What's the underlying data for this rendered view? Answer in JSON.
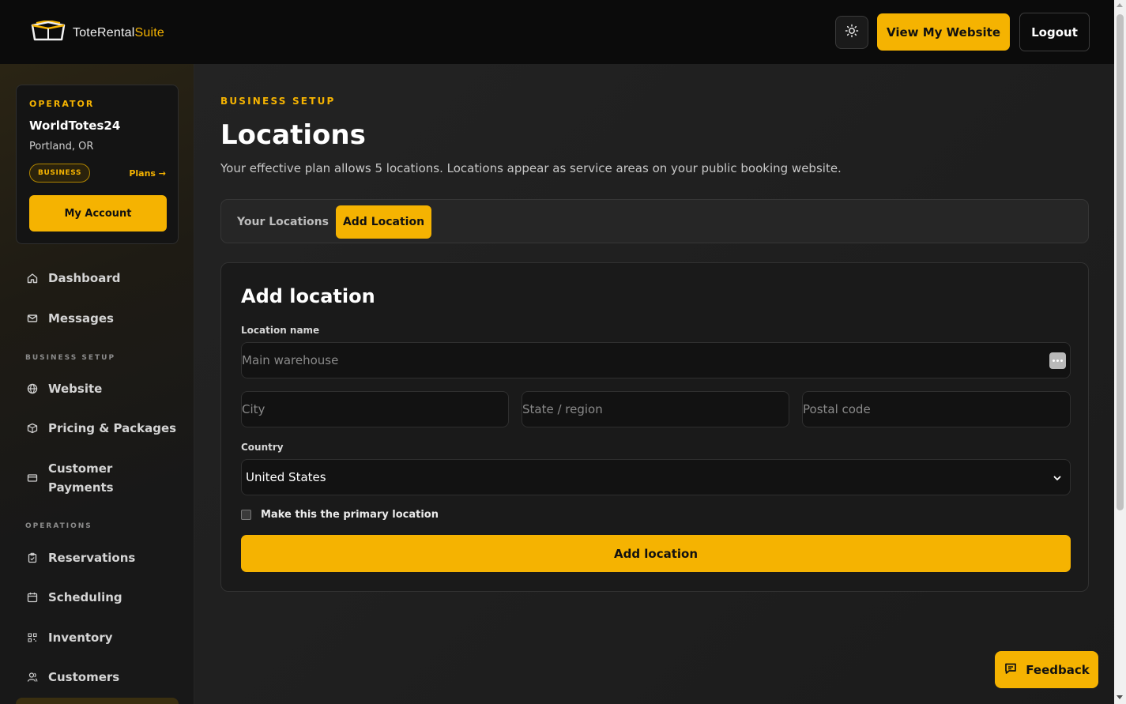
{
  "header": {
    "logo": {
      "part1": "ToteRental",
      "part2": "Suite"
    },
    "theme_toggle_icon": "sun-icon",
    "view_website_label": "View My Website",
    "logout_label": "Logout"
  },
  "sidebar": {
    "operator_label": "OPERATOR",
    "operator_name": "WorldTotes24",
    "operator_location": "Portland, OR",
    "plan_badge": "BUSINESS",
    "plans_link": "Plans →",
    "account_button": "My Account",
    "items": [
      {
        "label": "Dashboard",
        "icon": "home-icon"
      },
      {
        "label": "Messages",
        "icon": "mail-icon"
      },
      {
        "label": "Website",
        "icon": "globe-icon"
      },
      {
        "label": "Pricing & Packages",
        "icon": "package-icon"
      },
      {
        "label": "Customer Payments",
        "icon": "credit-card-icon"
      },
      {
        "label": "Reservations",
        "icon": "clipboard-icon"
      },
      {
        "label": "Scheduling",
        "icon": "calendar-icon"
      },
      {
        "label": "Inventory",
        "icon": "grid-icon"
      },
      {
        "label": "Customers",
        "icon": "users-icon"
      }
    ],
    "sections": {
      "business_setup": "BUSINESS SETUP",
      "operations": "OPERATIONS"
    }
  },
  "main": {
    "breadcrumb": "BUSINESS SETUP",
    "title": "Locations",
    "subtitle": "Your effective plan allows 5 locations. Locations appear as service areas on your public booking website.",
    "tabs": [
      {
        "label": "Your Locations",
        "active": false
      },
      {
        "label": "Add Location",
        "active": true
      }
    ],
    "form": {
      "title": "Add location",
      "location_name_label": "Location name",
      "location_name_placeholder": "Main warehouse",
      "city_placeholder": "City",
      "state_placeholder": "State / region",
      "postal_placeholder": "Postal code",
      "country_label": "Country",
      "country_value": "United States",
      "primary_checkbox_label": "Make this the primary location",
      "primary_checked": false,
      "submit_label": "Add location"
    }
  },
  "feedback_label": "Feedback",
  "colors": {
    "accent": "#f5b301",
    "background": "#1c1c1c",
    "header": "#0b0b0b"
  }
}
